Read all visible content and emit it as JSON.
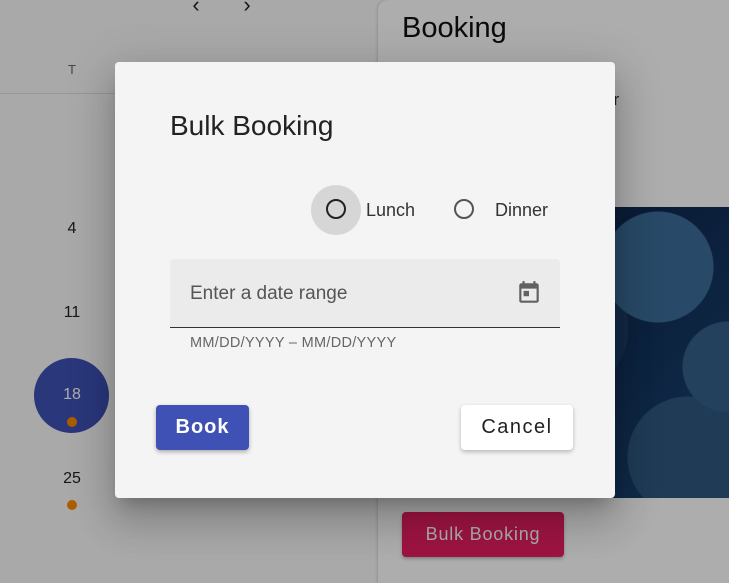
{
  "calendar": {
    "prev_arrow": "‹",
    "next_arrow": "›",
    "day_header": "T",
    "days": [
      "4",
      "11",
      "18",
      "25"
    ],
    "today": "18"
  },
  "booking_panel": {
    "title": "Booking",
    "subtitle_fragment": "er",
    "bulk_booking_label": "Bulk Booking"
  },
  "dialog": {
    "title": "Bulk Booking",
    "meal_options": [
      "Lunch",
      "Dinner"
    ],
    "date_range": {
      "placeholder": "Enter a date range",
      "hint": "MM/DD/YYYY – MM/DD/YYYY"
    },
    "book_label": "Book",
    "cancel_label": "Cancel"
  },
  "colors": {
    "primary": "#3f51b5",
    "accent": "#e91e63",
    "event_dot": "#ff8a00"
  }
}
